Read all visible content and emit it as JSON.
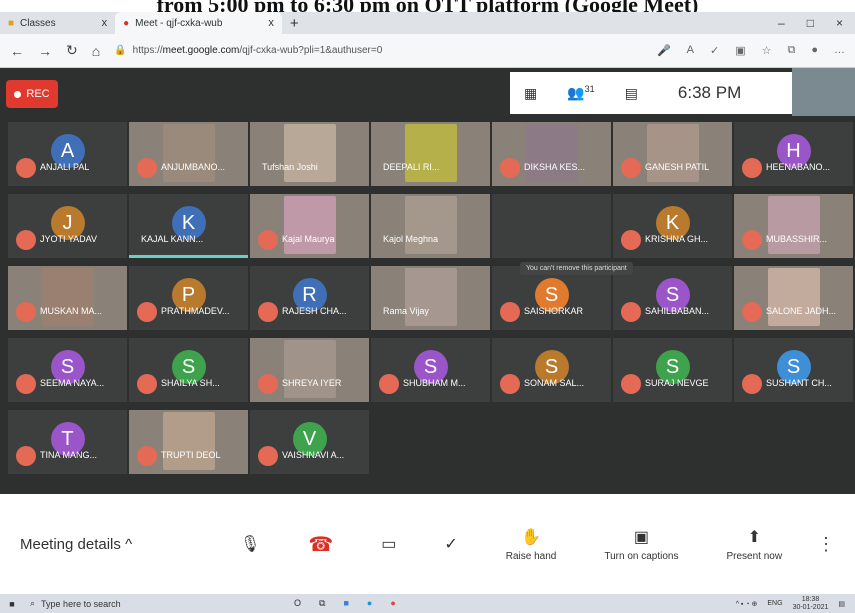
{
  "page_caption": "from 5:00 pm to 6:30 pm on OTT platform (Google Meet)",
  "browser": {
    "tabs": [
      {
        "label": "Classes",
        "close": "x"
      },
      {
        "label": "Meet - qjf-cxka-wub",
        "close": "x"
      }
    ],
    "new_tab": "+",
    "window_controls": [
      "–",
      "□",
      "×"
    ],
    "url_prefix": "https://",
    "url_domain": "meet.google.com",
    "url_rest": "/qjf-cxka-wub?pli=1&authuser=0"
  },
  "meeting": {
    "rec_label": "REC",
    "participant_count": "31",
    "time": "6:38 PM",
    "tooltip": "You can't remove this participant",
    "participants": [
      {
        "name": "ANJALI PAL",
        "initial": "A",
        "color": "#3f6fb6",
        "video": false,
        "muted": true
      },
      {
        "name": "ANJUMBANO...",
        "initial": "",
        "color": "#9a8a7c",
        "video": true,
        "muted": true
      },
      {
        "name": "Tufshan Joshi",
        "initial": "",
        "color": "#b8a898",
        "video": true,
        "muted": false
      },
      {
        "name": "DEEPALI RI...",
        "initial": "",
        "color": "#b5b04a",
        "video": true,
        "muted": false
      },
      {
        "name": "DIKSHA KES...",
        "initial": "",
        "color": "#8c7a86",
        "video": true,
        "muted": true
      },
      {
        "name": "GANESH PATIL",
        "initial": "",
        "color": "#a69488",
        "video": true,
        "muted": true
      },
      {
        "name": "HEENABANO...",
        "initial": "H",
        "color": "#9a55c9",
        "video": false,
        "muted": true
      },
      {
        "name": "JYOTI YADAV",
        "initial": "J",
        "color": "#b97a2e",
        "video": false,
        "muted": true
      },
      {
        "name": "KAJAL KANN...",
        "initial": "K",
        "color": "#3f6fb6",
        "video": false,
        "muted": false
      },
      {
        "name": "Kajal Maurya",
        "initial": "",
        "color": "#c099a8",
        "video": true,
        "muted": true
      },
      {
        "name": "Kajol Meghna",
        "initial": "",
        "color": "#a4978c",
        "video": true,
        "muted": false
      },
      {
        "name": "",
        "initial": "",
        "color": "#3c3f3e",
        "video": false,
        "muted": false
      },
      {
        "name": "KRISHNA GH...",
        "initial": "K",
        "color": "#b97a2e",
        "video": false,
        "muted": true
      },
      {
        "name": "MUBASSHIR...",
        "initial": "",
        "color": "#b89aa2",
        "video": true,
        "muted": true
      },
      {
        "name": "MUSKAN MA...",
        "initial": "",
        "color": "#9a8070",
        "video": true,
        "muted": true
      },
      {
        "name": "PRATHMADEV...",
        "initial": "P",
        "color": "#b97a2e",
        "video": false,
        "muted": true
      },
      {
        "name": "RAJESH CHA...",
        "initial": "R",
        "color": "#3f6fb6",
        "video": false,
        "muted": true
      },
      {
        "name": "Rama Vijay",
        "initial": "",
        "color": "#a69890",
        "video": true,
        "muted": false
      },
      {
        "name": "SAISHORKAR",
        "initial": "S",
        "color": "#e07a2e",
        "video": false,
        "muted": true
      },
      {
        "name": "SAHILBABAN...",
        "initial": "S",
        "color": "#9a55c9",
        "video": false,
        "muted": true
      },
      {
        "name": "SALONE JADH...",
        "initial": "",
        "color": "#c2aa9c",
        "video": true,
        "muted": true
      },
      {
        "name": "SEEMA NAYA...",
        "initial": "S",
        "color": "#9a55c9",
        "video": false,
        "muted": true
      },
      {
        "name": "SHAILYA SH...",
        "initial": "S",
        "color": "#3fa34d",
        "video": false,
        "muted": true
      },
      {
        "name": "SHREYA IYER",
        "initial": "",
        "color": "#a0948a",
        "video": true,
        "muted": true
      },
      {
        "name": "SHUBHAM M...",
        "initial": "S",
        "color": "#9a55c9",
        "video": false,
        "muted": true
      },
      {
        "name": "SONAM SAL...",
        "initial": "S",
        "color": "#b97a2e",
        "video": false,
        "muted": true
      },
      {
        "name": "SURAJ NEVGE",
        "initial": "S",
        "color": "#3fa34d",
        "video": false,
        "muted": true
      },
      {
        "name": "SUSHANT CH...",
        "initial": "S",
        "color": "#3f8fd6",
        "video": false,
        "muted": true
      },
      {
        "name": "TINA MANG...",
        "initial": "T",
        "color": "#9a55c9",
        "video": false,
        "muted": true
      },
      {
        "name": "TRUPTI DEOL",
        "initial": "",
        "color": "#b29c8a",
        "video": true,
        "muted": true
      },
      {
        "name": "VAISHNAVI A...",
        "initial": "V",
        "color": "#3fa34d",
        "video": false,
        "muted": true
      }
    ]
  },
  "controls": {
    "meeting_details": "Meeting details",
    "meeting_details_chevron": "^",
    "raise_hand": "Raise hand",
    "captions": "Turn on captions",
    "present": "Present now"
  },
  "taskbar": {
    "search_placeholder": "Type here to search",
    "clock_time": "18:38",
    "clock_date": "30-01-2021",
    "lang": "ENG"
  }
}
